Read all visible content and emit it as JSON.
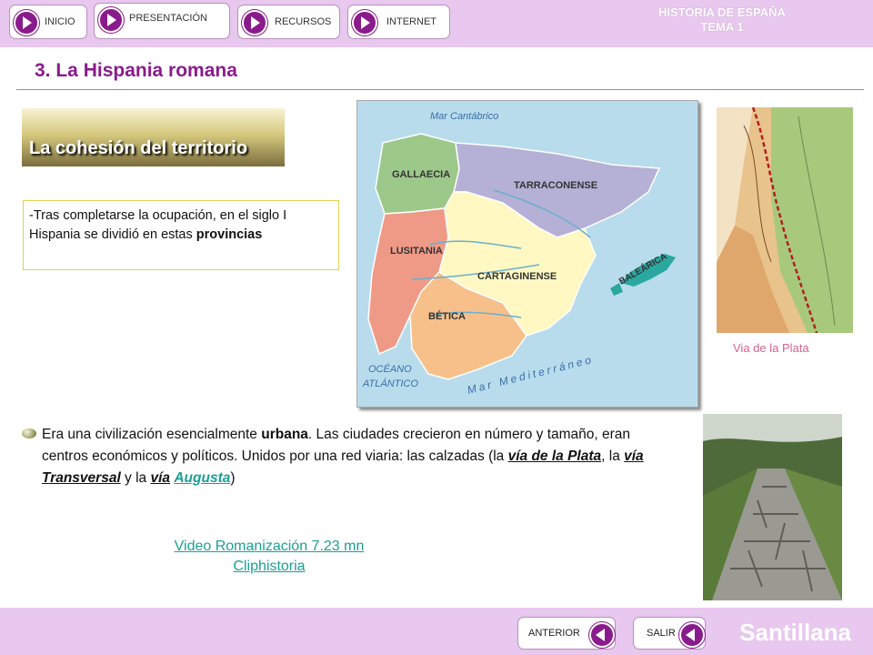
{
  "nav": {
    "inicio": "INICIO",
    "presentacion": "PRESENTACIÓN",
    "recursos": "RECURSOS",
    "internet": "INTERNET"
  },
  "header": {
    "course_line1": "HISTORIA DE ESPAÑA",
    "course_line2": "TEMA 1"
  },
  "page_title": "3. La Hispania romana",
  "section_title": "La cohesión del territorio",
  "intro": {
    "text": "-Tras completarse la ocupación, en el siglo I  Hispania se dividió en estas ",
    "bold": "provincias"
  },
  "map": {
    "labels": {
      "cantabrico": "Mar Cantábrico",
      "gallaecia": "GALLAECIA",
      "tarraconense": "TARRACONENSE",
      "lusitania": "LUSITANIA",
      "carthaginense": "CARTAGINENSE",
      "balearica": "BALEÁRICA",
      "betica": "BÉTICA",
      "oceano1": "OCÉANO",
      "oceano2": "ATLÁNTICO",
      "mediterraneo": "Mar Mediterráneo"
    }
  },
  "plata_caption": "Via de la Plata",
  "paragraph": {
    "p1": "Era una civilización esencialmente ",
    "urbana": "urbana",
    "p2": ". Las ciudades crecieron en número y tamaño, eran centros económicos y políticos. Unidos por una red viaria: las calzadas (la ",
    "via_plata": "vía de la Plata",
    "p3": ", la ",
    "via_transversal": "vía Transversal",
    "p4": " y la ",
    "via": "vía",
    "augusta": "Augusta",
    "p5": ")"
  },
  "video_link": {
    "line1": "Video Romanización 7.23 mn",
    "line2": "Cliphistoria"
  },
  "footer": {
    "anterior": "ANTERIOR",
    "salir": "SALIR",
    "brand": "Santillana"
  },
  "colors": {
    "accent": "#8a1b8c",
    "bar": "#e8c8ee",
    "link": "#1aa094"
  }
}
